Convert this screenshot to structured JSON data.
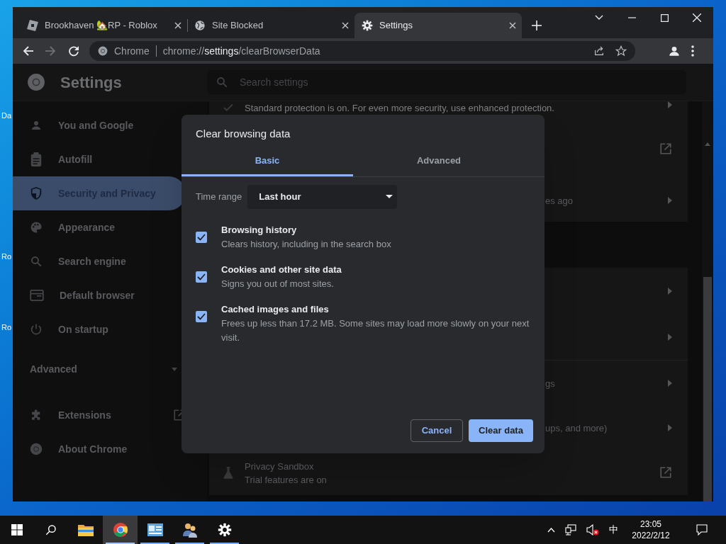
{
  "desktop": {
    "icon_labels": [
      "Da",
      "Ro",
      "Ro"
    ]
  },
  "browser": {
    "tabs": [
      {
        "kind": "tilted-square",
        "title": "Brookhaven 🏡RP - Roblox",
        "selected": false
      },
      {
        "kind": "globe",
        "title": "Site Blocked",
        "selected": false
      },
      {
        "kind": "gear",
        "title": "Settings",
        "selected": true
      }
    ],
    "toolbar": {
      "forward_disabled": true,
      "site_chip": "Chrome",
      "url": {
        "scheme": "chrome://",
        "host": "settings",
        "path": "/clearBrowserData"
      }
    },
    "settings": {
      "title": "Settings",
      "search": {
        "placeholder": "Search settings"
      },
      "sidebar": {
        "items": [
          {
            "kind": "person",
            "label": "You and Google",
            "selected": false
          },
          {
            "kind": "clipboard",
            "label": "Autofill",
            "selected": false
          },
          {
            "kind": "shield",
            "label": "Security and Privacy",
            "selected": true
          },
          {
            "kind": "palette",
            "label": "Appearance",
            "selected": false
          },
          {
            "kind": "search",
            "label": "Search engine",
            "selected": false
          },
          {
            "kind": "browser-window",
            "label": "Default browser",
            "selected": false
          },
          {
            "kind": "power",
            "label": "On startup",
            "selected": false
          }
        ],
        "advanced": {
          "label": "Advanced",
          "expanded": false
        },
        "footer_items": [
          {
            "kind": "puzzle",
            "label": "Extensions",
            "external": true
          },
          {
            "kind": "logo",
            "label": "About Chrome",
            "external": false
          }
        ]
      },
      "sections": [
        {
          "rows": [
            {
              "kind": "arrow",
              "subtitle": "Standard protection is on. For even more security, use enhanced protection."
            },
            {
              "kind": "link"
            },
            {
              "kind": "arrow",
              "subtitle": "es ago"
            }
          ]
        },
        {
          "rows": [
            {
              "kind": "arrow"
            },
            {
              "kind": "arrow"
            }
          ]
        },
        {
          "rows": [
            {
              "kind": "arrow",
              "subtitle": "gs"
            },
            {
              "kind": "arrow",
              "subtitle": "ups, and more)"
            },
            {
              "kind": "link",
              "title": "Privacy Sandbox",
              "subtitle": "Trial features are on"
            }
          ]
        }
      ]
    },
    "dialog": {
      "title": "Clear browsing data",
      "tabs": [
        {
          "label": "Basic",
          "selected": true
        },
        {
          "label": "Advanced",
          "selected": false
        }
      ],
      "time_range": {
        "label": "Time range",
        "value": "Last hour"
      },
      "items": [
        {
          "title": "Browsing history",
          "description": "Clears history, including in the search box",
          "checked": true
        },
        {
          "title": "Cookies and other site data",
          "description": "Signs you out of most sites.",
          "checked": true
        },
        {
          "title": "Cached images and files",
          "description": "Frees up less than 17.2 MB. Some sites may load more slowly on your next visit.",
          "checked": true
        }
      ],
      "buttons": [
        {
          "kind": "secondary",
          "label": "Cancel"
        },
        {
          "kind": "primary",
          "label": "Clear data"
        }
      ]
    }
  },
  "taskbar": {
    "apps": [
      {
        "kind": "folder",
        "running": false,
        "selected": false
      },
      {
        "kind": "browser",
        "running": true,
        "selected": true
      },
      {
        "kind": "panel",
        "running": true,
        "selected": false
      },
      {
        "kind": "people",
        "running": true,
        "selected": false
      },
      {
        "kind": "gear",
        "running": true,
        "selected": false
      }
    ],
    "tray": {
      "input_method": "中",
      "time": "23:05",
      "date": "2022/2/12"
    }
  }
}
